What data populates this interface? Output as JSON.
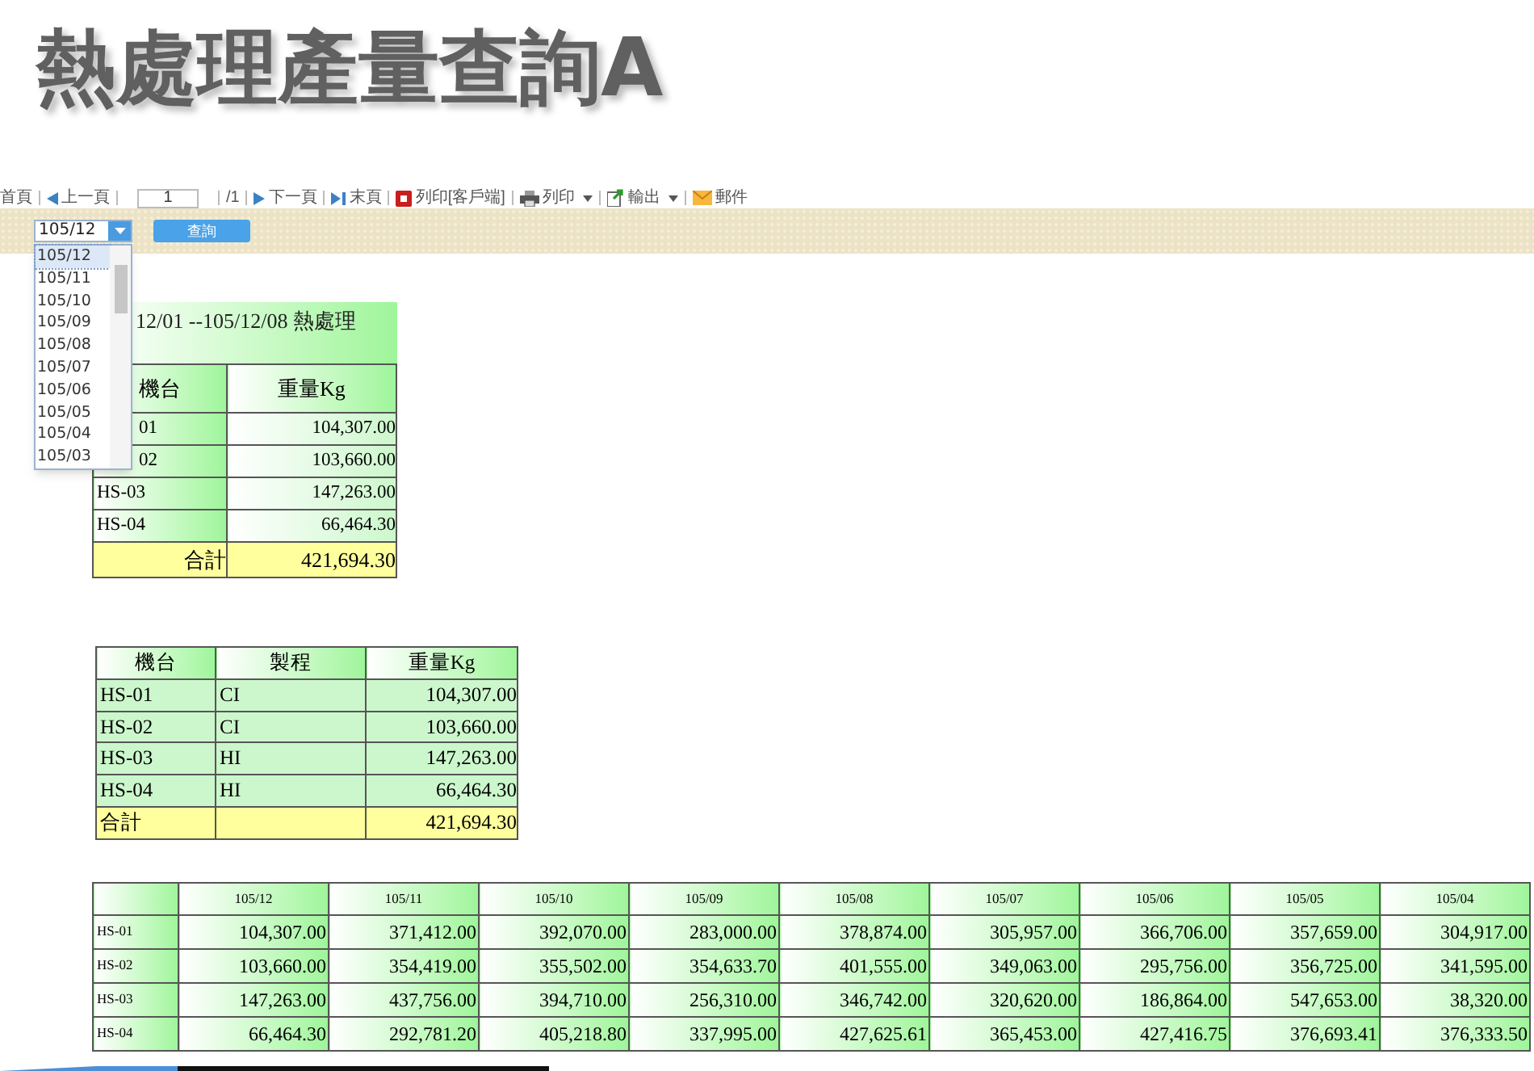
{
  "slide_title": "熱處理產量查詢A",
  "toolbar": {
    "items": [
      {
        "kind": "text",
        "label": "首頁"
      },
      {
        "kind": "prev",
        "label": "上一頁"
      },
      {
        "kind": "page",
        "value": "1"
      },
      {
        "kind": "text",
        "label": "/1"
      },
      {
        "kind": "next",
        "label": "下一頁"
      },
      {
        "kind": "last",
        "label": "末頁"
      },
      {
        "kind": "pdf",
        "label": "列印[客戶端]"
      },
      {
        "kind": "print",
        "label": "列印",
        "menu": true
      },
      {
        "kind": "export",
        "label": "輸出",
        "menu": true
      },
      {
        "kind": "mail",
        "label": "郵件"
      }
    ]
  },
  "query": {
    "month_select": "105/12",
    "button": "查詢",
    "dropdown": [
      {
        "label": "105/12",
        "selected": true
      },
      {
        "label": "105/11",
        "selected": false
      },
      {
        "label": "105/10",
        "selected": false
      },
      {
        "label": "105/09",
        "selected": false
      },
      {
        "label": "105/08",
        "selected": false
      },
      {
        "label": "105/07",
        "selected": false
      },
      {
        "label": "105/06",
        "selected": false
      },
      {
        "label": "105/05",
        "selected": false
      },
      {
        "label": "105/04",
        "selected": false
      },
      {
        "label": "105/03",
        "selected": false
      }
    ]
  },
  "summary_table": {
    "caption": "12/01 --105/12/08 熱處理",
    "columns": [
      "機台",
      "重量Kg"
    ],
    "rows": [
      [
        "01",
        "104,307.00"
      ],
      [
        "02",
        "103,660.00"
      ],
      [
        "HS-03",
        "147,263.00"
      ],
      [
        "HS-04",
        "66,464.30"
      ]
    ],
    "total": {
      "label": "合計",
      "value": "421,694.30"
    }
  },
  "process_table": {
    "columns": [
      "機台",
      "製程",
      "重量Kg"
    ],
    "rows": [
      [
        "HS-01",
        "CI",
        "104,307.00"
      ],
      [
        "HS-02",
        "CI",
        "103,660.00"
      ],
      [
        "HS-03",
        "HI",
        "147,263.00"
      ],
      [
        "HS-04",
        "HI",
        "66,464.30"
      ]
    ],
    "total": {
      "label": "合計",
      "value": "421,694.30"
    }
  },
  "monthly_table": {
    "columns": [
      "105/12",
      "105/11",
      "105/10",
      "105/09",
      "105/08",
      "105/07",
      "105/06",
      "105/05",
      "105/04"
    ],
    "rows": [
      {
        "machine": "HS-01",
        "values": [
          "104,307.00",
          "371,412.00",
          "392,070.00",
          "283,000.00",
          "378,874.00",
          "305,957.00",
          "366,706.00",
          "357,659.00",
          "304,917.00"
        ]
      },
      {
        "machine": "HS-02",
        "values": [
          "103,660.00",
          "354,419.00",
          "355,502.00",
          "354,633.70",
          "401,555.00",
          "349,063.00",
          "295,756.00",
          "356,725.00",
          "341,595.00"
        ]
      },
      {
        "machine": "HS-03",
        "values": [
          "147,263.00",
          "437,756.00",
          "394,710.00",
          "256,310.00",
          "346,742.00",
          "320,620.00",
          "186,864.00",
          "547,653.00",
          "38,320.00"
        ]
      },
      {
        "machine": "HS-04",
        "values": [
          "66,464.30",
          "292,781.20",
          "405,218.80",
          "337,995.00",
          "427,625.61",
          "365,453.00",
          "427,416.75",
          "376,693.41",
          "376,333.50"
        ]
      }
    ]
  }
}
